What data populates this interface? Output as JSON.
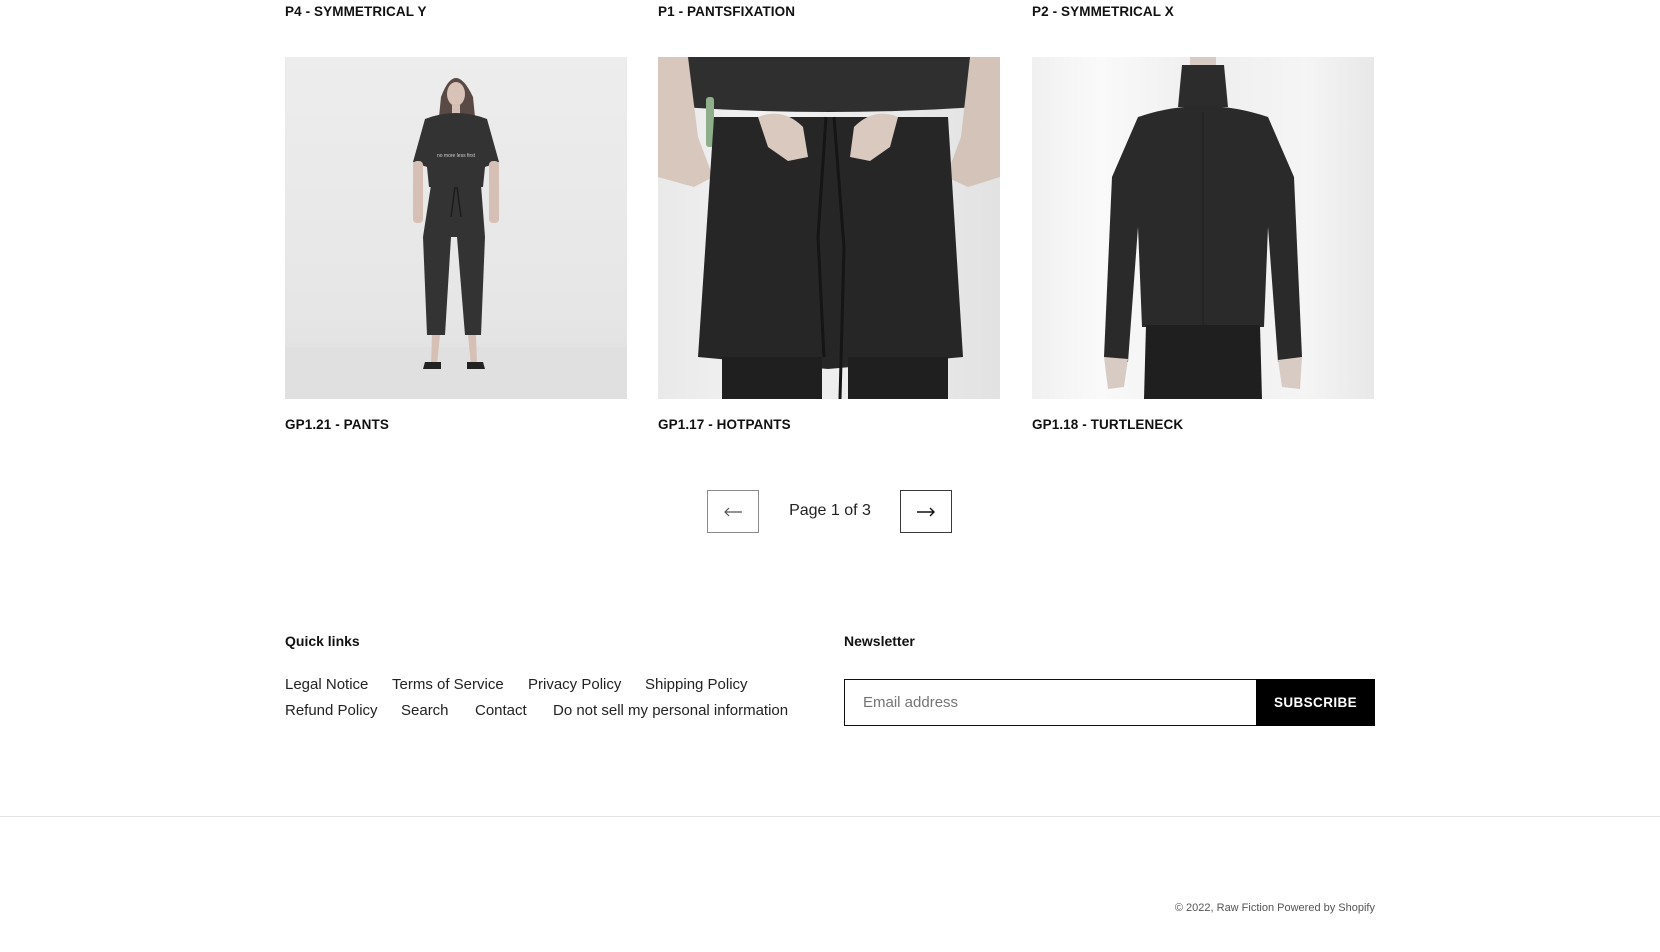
{
  "products_top": [
    {
      "title": "P4 - SYMMETRICAL Y"
    },
    {
      "title": "P1 - PANTSFIXATION"
    },
    {
      "title": "P2 - SYMMETRICAL X"
    }
  ],
  "products": [
    {
      "title": "GP1.21 - PANTS",
      "image": "model-pants-image"
    },
    {
      "title": "GP1.17 - HOTPANTS",
      "image": "hotpants-image"
    },
    {
      "title": "GP1.18 - TURTLENECK",
      "image": "turtleneck-image"
    }
  ],
  "pagination": {
    "label": "Page 1 of 3",
    "prev_icon": "arrow-left-icon",
    "next_icon": "arrow-right-icon",
    "current_page": 1,
    "total_pages": 3
  },
  "footer": {
    "quick_links_title": "Quick links",
    "quick_links": [
      "Legal Notice",
      "Terms of Service",
      "Privacy Policy",
      "Shipping Policy",
      "Refund Policy",
      "Search",
      "Contact",
      "Do not sell my personal information"
    ],
    "newsletter_title": "Newsletter",
    "email_placeholder": "Email address",
    "subscribe_label": "SUBSCRIBE",
    "copyright_prefix": "© 2022, ",
    "store_name": "Raw Fiction",
    "powered_by": "Powered by Shopify"
  },
  "colors": {
    "text": "#111111",
    "button_bg": "#000000",
    "button_text": "#ffffff",
    "divider": "#e4e4e4"
  }
}
